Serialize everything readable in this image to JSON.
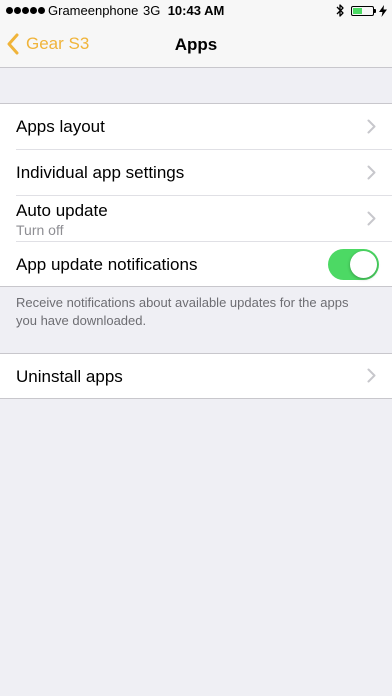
{
  "status_bar": {
    "carrier": "Grameenphone",
    "network": "3G",
    "time": "10:43 AM",
    "battery_level": 0.45,
    "battery_color": "#4cd964"
  },
  "nav": {
    "back_label": "Gear S3",
    "title": "Apps",
    "accent_color": "#f0b43a"
  },
  "settings": {
    "rows": [
      {
        "title": "Apps layout"
      },
      {
        "title": "Individual app settings"
      },
      {
        "title": "Auto update",
        "subtitle": "Turn off"
      },
      {
        "title": "App update notifications",
        "toggle_on": true
      }
    ],
    "footnote": "Receive notifications about available updates for the apps you have downloaded.",
    "uninstall": {
      "title": "Uninstall apps"
    }
  },
  "icons": {
    "signal": "signal-dots-icon",
    "bluetooth": "bluetooth-icon",
    "battery": "battery-icon",
    "charging": "charging-bolt-icon",
    "back": "chevron-left-icon",
    "disclosure": "chevron-right-icon"
  }
}
